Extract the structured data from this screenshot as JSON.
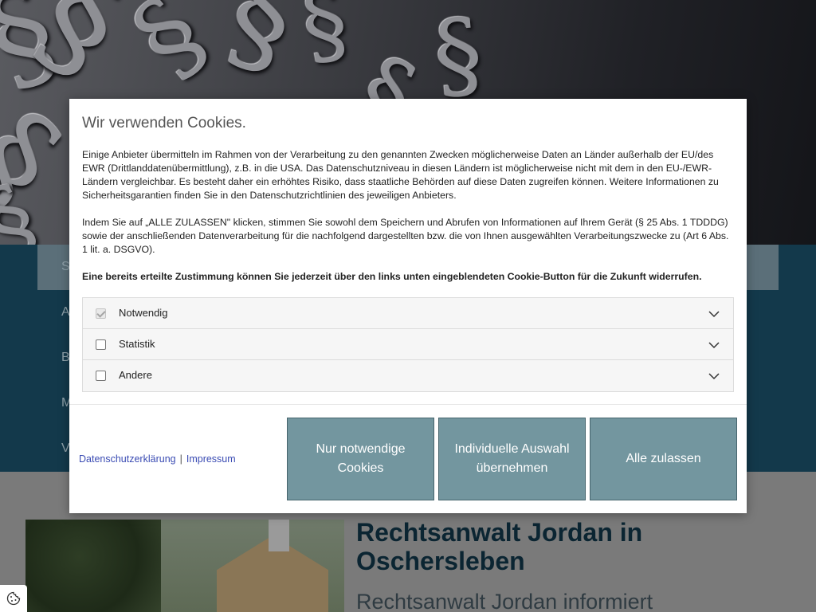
{
  "modal": {
    "title": "Wir verwenden Cookies.",
    "paragraph_1": "Einige Anbieter übermitteln im Rahmen von der Verarbeitung zu den genannten Zwecken möglicherweise Daten an Länder außerhalb der EU/des EWR (Drittlanddatenübermittlung), z.B. in die USA. Das Datenschutzniveau in diesen Ländern ist möglicherweise nicht mit dem in den EU-/EWR-Ländern vergleichbar. Es besteht daher ein erhöhtes Risiko, dass staatliche Behörden auf diese Daten zugreifen können. Weitere Informationen zu Sicherheitsgarantien finden Sie in den Datenschutzrichtlinien des jeweiligen Anbieters.",
    "paragraph_2": "Indem Sie auf „ALLE ZULASSEN\" klicken, stimmen Sie sowohl dem Speichern und Abrufen von Informationen auf Ihrem Gerät (§ 25 Abs. 1 TDDDG) sowie der anschließenden Datenverarbeitung für die nachfolgend dargestellten bzw. die von Ihnen ausgewählten Verarbeitungszwecke zu (Art 6 Abs. 1 lit. a. DSGVO).",
    "paragraph_3": "Eine bereits erteilte Zustimmung können Sie jederzeit über den links unten eingeblendeten Cookie-Button für die Zukunft widerrufen.",
    "categories": [
      {
        "label": "Notwendig",
        "checked": true,
        "disabled": true
      },
      {
        "label": "Statistik",
        "checked": false,
        "disabled": false
      },
      {
        "label": "Andere",
        "checked": false,
        "disabled": false
      }
    ],
    "links": {
      "privacy": "Datenschutzerklärung",
      "separator": "|",
      "imprint": "Impressum"
    },
    "buttons": {
      "necessary_only": "Nur notwendige Cookies",
      "custom_selection": "Individuelle Auswahl übernehmen",
      "accept_all": "Alle zulassen"
    }
  },
  "page": {
    "nav_letters": [
      "S",
      "A",
      "B",
      "M",
      "V"
    ],
    "title": "Rechtsanwalt Jordan in Oschersleben",
    "subtitle": "Rechtsanwalt Jordan informiert"
  },
  "colors": {
    "nav_band": "#13394b",
    "button_bg": "#73969f",
    "link": "#3a4bb3",
    "title": "#0b2532"
  },
  "icons": {
    "hero_decoration": "§",
    "cookie_fab": "cookie-icon",
    "accordion": "chevron-down-icon"
  }
}
